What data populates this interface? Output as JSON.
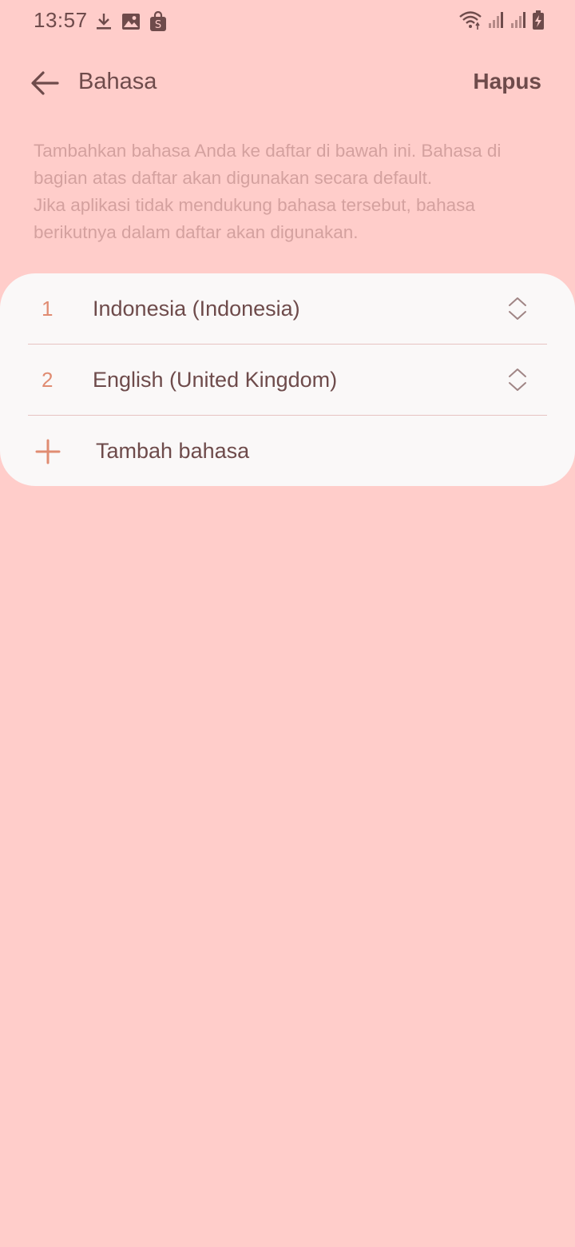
{
  "status_bar": {
    "time": "13:57",
    "left_icons": [
      "download-icon",
      "image-icon",
      "shop-bag-icon"
    ],
    "right_icons": [
      "wifi-icon",
      "signal-icon",
      "signal-icon",
      "battery-charging-icon"
    ]
  },
  "header": {
    "title": "Bahasa",
    "action_label": "Hapus"
  },
  "description": {
    "line1": "Tambahkan bahasa Anda ke daftar di bawah ini. Bahasa di bagian atas daftar akan digunakan secara default.",
    "line2": "Jika aplikasi tidak mendukung bahasa tersebut, bahasa berikutnya dalam daftar akan digunakan."
  },
  "languages": [
    {
      "index": "1",
      "name": "Indonesia (Indonesia)"
    },
    {
      "index": "2",
      "name": "English (United Kingdom)"
    }
  ],
  "add_language": {
    "label": "Tambah bahasa"
  },
  "colors": {
    "background": "#FFCDCA",
    "card": "#FAF8F8",
    "text_primary": "#6E4B4B",
    "text_secondary": "#D4A19F",
    "accent": "#E08C72"
  }
}
